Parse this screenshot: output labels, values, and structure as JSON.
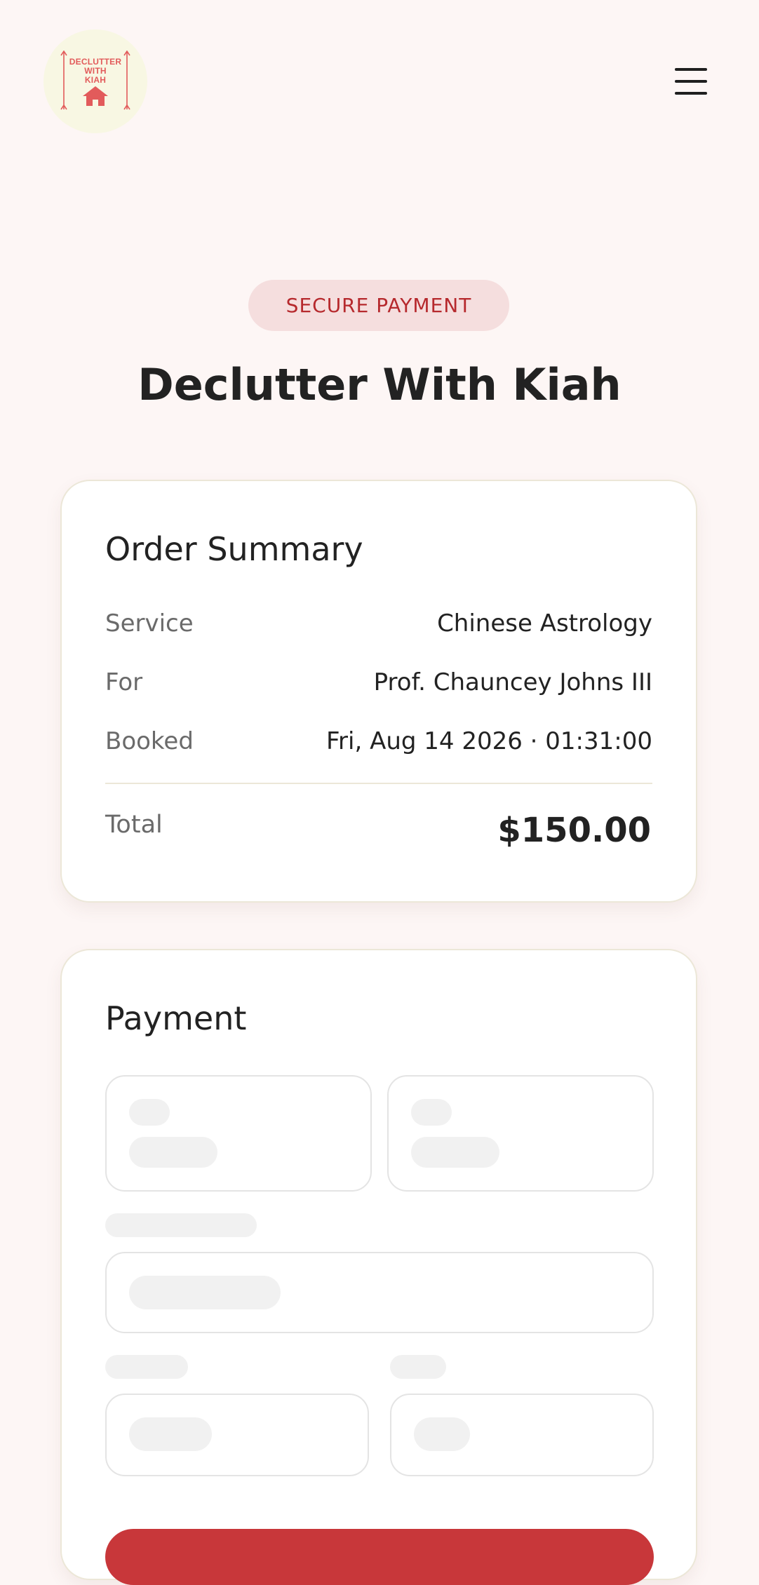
{
  "header": {
    "logo_text": "DECLUTTER WITH KIAH",
    "logo_icon": "house-icon",
    "menu_icon": "hamburger-menu-icon"
  },
  "badge": "SECURE PAYMENT",
  "title": "Declutter With Kiah",
  "summary": {
    "heading": "Order Summary",
    "rows": [
      {
        "label": "Service",
        "value": "Chinese Astrology"
      },
      {
        "label": "For",
        "value": "Prof. Chauncey Johns III"
      },
      {
        "label": "Booked",
        "value": "Fri, Aug 14 2026 · 01:31:00"
      }
    ],
    "total_label": "Total",
    "total_value": "$150.00"
  },
  "payment": {
    "heading": "Payment",
    "state": "loading"
  },
  "colors": {
    "accent": "#c8373a",
    "badge_bg": "#f5dede",
    "badge_text": "#b6292d",
    "page_bg": "#fdf6f5",
    "logo_bg": "#f8f7e3",
    "logo_red": "#e25b5b"
  }
}
